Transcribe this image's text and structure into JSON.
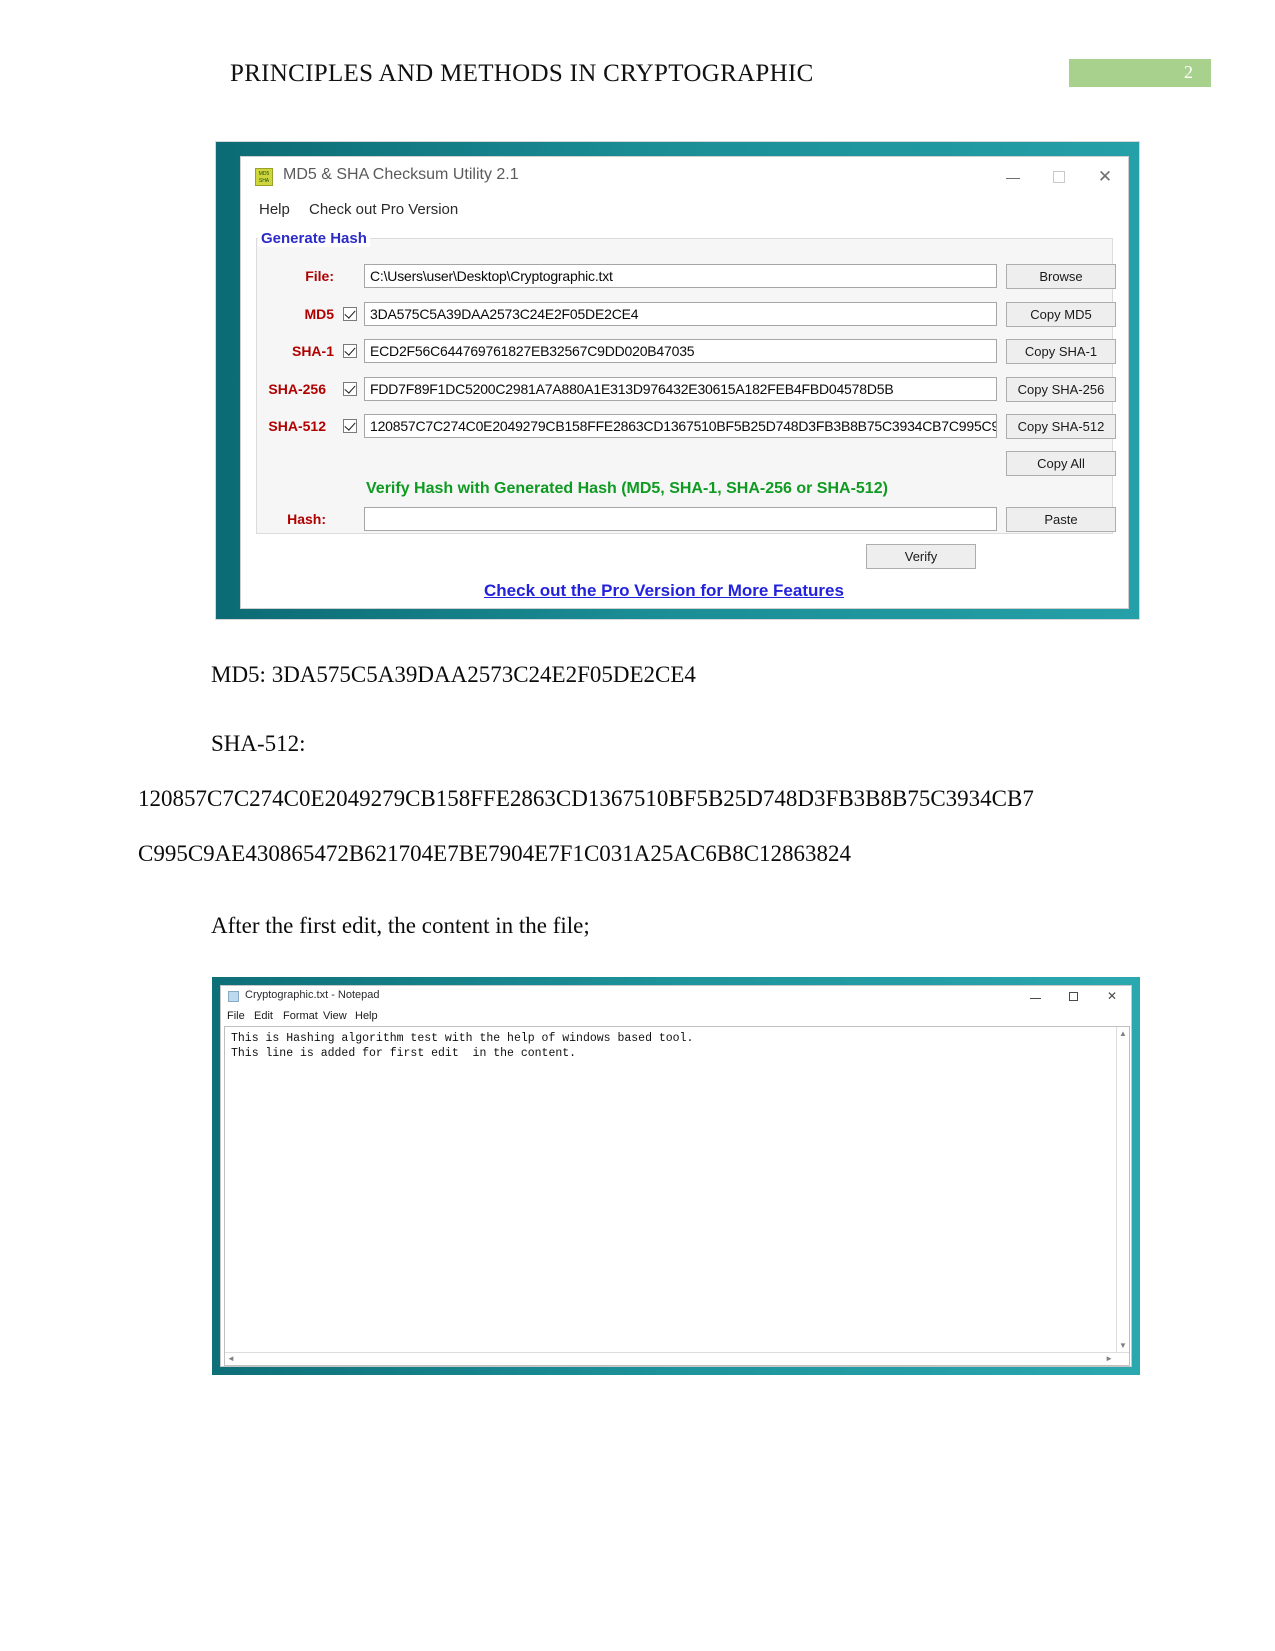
{
  "header": {
    "title": "PRINCIPLES AND METHODS IN CRYPTOGRAPHIC",
    "page_number": "2",
    "badge_color": "#a9d18e"
  },
  "md5_window": {
    "title": "MD5 & SHA Checksum Utility 2.1",
    "icon_line1": "MD5",
    "icon_line2": "SHA",
    "window_controls": {
      "minimize": "–",
      "maximize": "□",
      "close": "✕"
    },
    "menu": [
      "Help",
      "Check out Pro Version"
    ],
    "group_label": "Generate Hash",
    "rows": [
      {
        "label": "File:",
        "value": "C:\\Users\\user\\Desktop\\Cryptographic.txt",
        "button": "Browse",
        "has_checkbox": false
      },
      {
        "label": "MD5",
        "value": "3DA575C5A39DAA2573C24E2F05DE2CE4",
        "button": "Copy MD5",
        "has_checkbox": true
      },
      {
        "label": "SHA-1",
        "value": "ECD2F56C644769761827EB32567C9DD020B47035",
        "button": "Copy SHA-1",
        "has_checkbox": true
      },
      {
        "label": "SHA-256",
        "value": "FDD7F89F1DC5200C2981A7A880A1E313D976432E30615A182FEB4FBD04578D5B",
        "button": "Copy SHA-256",
        "has_checkbox": true
      },
      {
        "label": "SHA-512",
        "value": "120857C7C274C0E2049279CB158FFE2863CD1367510BF5B25D748D3FB3B8B75C3934CB7C995C9AE430865472B621704E7BE7904E7F1C031A25AC6B8C12863824",
        "button": "Copy SHA-512",
        "has_checkbox": true
      }
    ],
    "copy_all_label": "Copy All",
    "verify_title": "Verify Hash with Generated Hash (MD5, SHA-1, SHA-256 or SHA-512)",
    "hash_label": "Hash:",
    "hash_value": "",
    "paste_label": "Paste",
    "verify_label": "Verify",
    "pro_link": "Check out the Pro Version for More Features"
  },
  "body": {
    "md5_line": "MD5: 3DA575C5A39DAA2573C24E2F05DE2CE4",
    "sha512_label": "SHA-512:",
    "sha512_line1": "120857C7C274C0E2049279CB158FFE2863CD1367510BF5B25D748D3FB3B8B75C3934CB7",
    "sha512_line2": "C995C9AE430865472B621704E7BE7904E7F1C031A25AC6B8C12863824",
    "after_edit_text": "After the first edit, the content in the file;"
  },
  "notepad_window": {
    "title": "Cryptographic.txt - Notepad",
    "window_controls": {
      "minimize": "–",
      "maximize": "□",
      "close": "✕"
    },
    "menu": [
      "File",
      "Edit",
      "Format",
      "View",
      "Help"
    ],
    "content_line1": "This is Hashing algorithm test with the help of windows based tool.",
    "content_line2": "This line is added for first edit  in the content.",
    "scroll_up_arrow": "▲",
    "scroll_down_arrow": "▼",
    "scroll_left_arrow": "◄",
    "scroll_right_arrow": "►"
  }
}
